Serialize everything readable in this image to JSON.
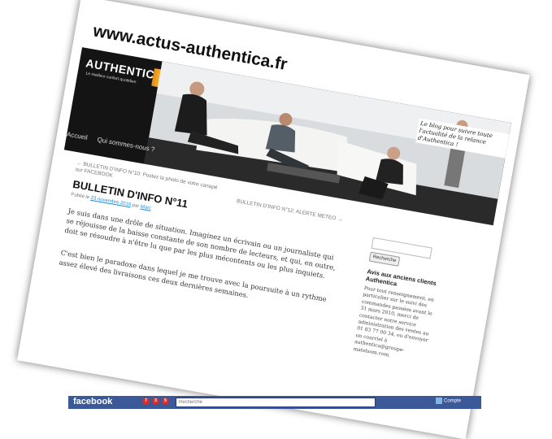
{
  "site": {
    "title": "www.actus-authentica.fr",
    "header_quote": "Le blog pour suivre toute l'actualité de la relance d'Authentica !"
  },
  "logo": {
    "brand": "AUTHENTICA",
    "tagline": "Le meilleur confort quotidien"
  },
  "nav": {
    "items": [
      "Accueil",
      "Qui sommes-nous ?"
    ]
  },
  "post_nav": {
    "prev": "← BULLETIN D'INFO N°10: Postez la photo de votre canapé sur FACEBOOK",
    "next": "BULLETIN D'INFO N°12: ALERTE METEO →"
  },
  "post": {
    "title": "BULLETIN D'INFO N°11",
    "meta_prefix": "Publié le",
    "date": "23 novembre 2010",
    "meta_by": "par",
    "author": "Marc",
    "paragraphs": [
      "Je suis dans une drôle de situation. Imaginez un écrivain ou un journaliste qui se réjouisse de la baisse constante de son nombre de lecteurs, et qui, en outre, doit se résoudre à n'être lu que par les plus mécontents ou les plus inquiets.",
      "C'est bien le paradoxe dans lequel je me trouve avec la poursuite à un rythme assez élevé des livraisons ces deux dernières semaines."
    ]
  },
  "sidebar": {
    "search_value": "",
    "search_button": "Recherche",
    "widget_title": "Avis aux anciens clients Authentica",
    "widget_text": "Pour tout renseignement, en particulier sur le suivi des commandes passées avant le 31 mars 2010, merci de contacter notre service administration des ventes au 01 83 77 00 34, ou d'envoyer un courriel à authentica@groupe-matelsom.com."
  },
  "facebook": {
    "logo": "facebook",
    "badges": [
      "7",
      "3",
      "5"
    ],
    "search_placeholder": "Recherche",
    "right_label": "Compte"
  },
  "colors": {
    "facebook_blue": "#3b5998",
    "link_blue": "#1b8be0",
    "logo_orange": "#f6b936"
  }
}
